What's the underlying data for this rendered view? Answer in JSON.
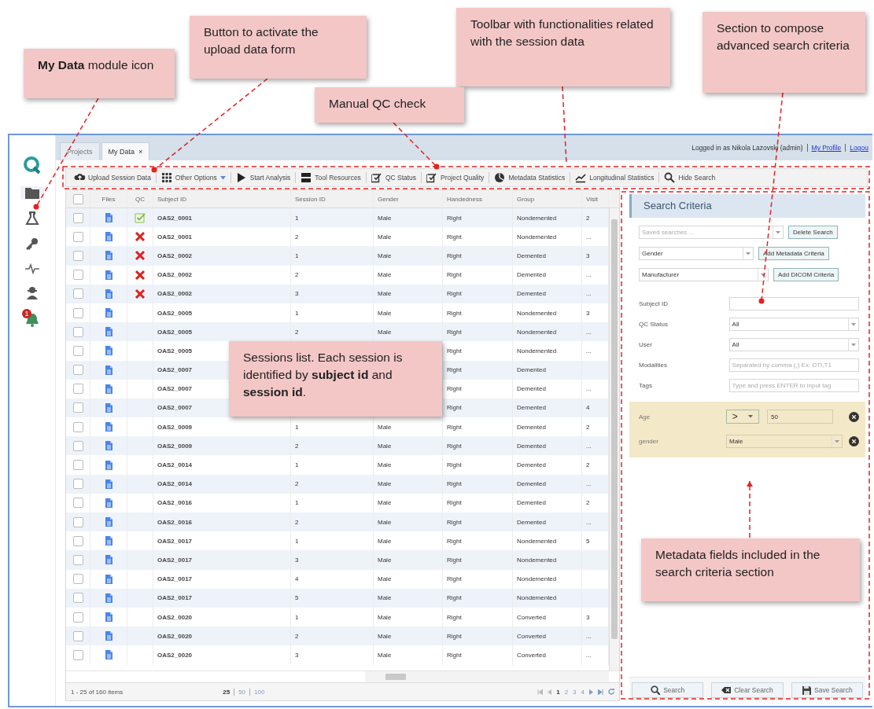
{
  "annotations": [
    {
      "text": "**My Data** module icon"
    },
    {
      "text": "Button to activate the upload data form"
    },
    {
      "text": "Toolbar with functionalities related with the session data"
    },
    {
      "text": "Manual QC check"
    },
    {
      "text": "Section to compose advanced search criteria"
    },
    {
      "text": "Sessions list. Each session is identified by **subject id** and **session id**."
    },
    {
      "text": "Metadata fields included in the search criteria section"
    }
  ],
  "sidebar": {
    "items": [
      {
        "selected": false
      },
      {
        "selected": true
      },
      {
        "selected": false
      },
      {
        "selected": false
      },
      {
        "selected": false
      },
      {
        "selected": false
      },
      {
        "selected": false,
        "badge": "1"
      }
    ]
  },
  "tabs": [
    {
      "label": "Projects",
      "selected": false
    },
    {
      "label": "My Data",
      "selected": true,
      "close": "×"
    }
  ],
  "user_bar": [
    {
      "kind": "text",
      "text": "Logged in as  Nikola Lazovski (admin)"
    },
    {
      "kind": "link",
      "text": "My Profile"
    },
    {
      "kind": "link",
      "text": "Logou"
    }
  ],
  "toolbar": [
    {
      "label": "Upload Session Data",
      "dropdown": false
    },
    {
      "label": "Other Options",
      "dropdown": true
    },
    {
      "label": "Start Analysis",
      "dropdown": false
    },
    {
      "label": "Tool Resources",
      "dropdown": false
    },
    {
      "label": "QC Status",
      "dropdown": false
    },
    {
      "label": "Project Quality",
      "dropdown": false
    },
    {
      "label": "Metadata Statistics",
      "dropdown": false
    },
    {
      "label": "Longitudinal Statistics",
      "dropdown": false
    },
    {
      "label": "Hide Search",
      "dropdown": false
    }
  ],
  "table": {
    "header_checked": false,
    "columns": [
      "Files",
      "QC",
      "Subject ID",
      "Session ID",
      "Gender",
      "Handedness",
      "Group",
      "Visit"
    ],
    "rows": [
      {
        "checked": false,
        "qc_passed": true,
        "subject_id": "OAS2_0001",
        "session_id": "1",
        "gender": "Male",
        "handedness": "Right",
        "group": "Nondemented",
        "visit": "2"
      },
      {
        "checked": false,
        "qc_passed": false,
        "subject_id": "OAS2_0001",
        "session_id": "2",
        "gender": "Male",
        "handedness": "Right",
        "group": "Nondemented",
        "visit": "..."
      },
      {
        "checked": false,
        "qc_passed": false,
        "subject_id": "OAS2_0002",
        "session_id": "1",
        "gender": "Male",
        "handedness": "Right",
        "group": "Demented",
        "visit": "3"
      },
      {
        "checked": false,
        "qc_passed": false,
        "subject_id": "OAS2_0002",
        "session_id": "2",
        "gender": "Male",
        "handedness": "Right",
        "group": "Demented",
        "visit": "..."
      },
      {
        "checked": false,
        "qc_passed": false,
        "subject_id": "OAS2_0002",
        "session_id": "3",
        "gender": "Male",
        "handedness": "Right",
        "group": "Demented",
        "visit": "..."
      },
      {
        "checked": false,
        "subject_id": "OAS2_0005",
        "session_id": "1",
        "gender": "Male",
        "handedness": "Right",
        "group": "Nondemented",
        "visit": "3"
      },
      {
        "checked": false,
        "subject_id": "OAS2_0005",
        "session_id": "2",
        "gender": "Male",
        "handedness": "Right",
        "group": "Nondemented",
        "visit": "..."
      },
      {
        "checked": false,
        "subject_id": "OAS2_0005",
        "handedness": "Right",
        "group": "Nondemented",
        "visit": "..."
      },
      {
        "checked": false,
        "subject_id": "OAS2_0007",
        "handedness": "Right",
        "group": "Demented"
      },
      {
        "checked": false,
        "subject_id": "OAS2_0007",
        "handedness": "Right",
        "group": "Demented",
        "visit": "..."
      },
      {
        "checked": false,
        "subject_id": "OAS2_0007",
        "handedness": "Right",
        "group": "Demented",
        "visit": "4"
      },
      {
        "checked": false,
        "subject_id": "OAS2_0009",
        "session_id": "1",
        "gender": "Male",
        "handedness": "Right",
        "group": "Demented",
        "visit": "2"
      },
      {
        "checked": false,
        "subject_id": "OAS2_0009",
        "session_id": "2",
        "gender": "Male",
        "handedness": "Right",
        "group": "Demented",
        "visit": "..."
      },
      {
        "checked": false,
        "subject_id": "OAS2_0014",
        "session_id": "1",
        "gender": "Male",
        "handedness": "Right",
        "group": "Demented",
        "visit": "2"
      },
      {
        "checked": false,
        "subject_id": "OAS2_0014",
        "session_id": "2",
        "gender": "Male",
        "handedness": "Right",
        "group": "Demented",
        "visit": "..."
      },
      {
        "checked": false,
        "subject_id": "OAS2_0016",
        "session_id": "1",
        "gender": "Male",
        "handedness": "Right",
        "group": "Demented",
        "visit": "2"
      },
      {
        "checked": false,
        "subject_id": "OAS2_0016",
        "session_id": "2",
        "gender": "Male",
        "handedness": "Right",
        "group": "Demented",
        "visit": "..."
      },
      {
        "checked": false,
        "subject_id": "OAS2_0017",
        "session_id": "1",
        "gender": "Male",
        "handedness": "Right",
        "group": "Nondemented",
        "visit": "5"
      },
      {
        "checked": false,
        "subject_id": "OAS2_0017",
        "session_id": "3",
        "gender": "Male",
        "handedness": "Right",
        "group": "Nondemented"
      },
      {
        "checked": false,
        "subject_id": "OAS2_0017",
        "session_id": "4",
        "gender": "Male",
        "handedness": "Right",
        "group": "Nondemented"
      },
      {
        "checked": false,
        "subject_id": "OAS2_0017",
        "session_id": "5",
        "gender": "Male",
        "handedness": "Right",
        "group": "Nondemented"
      },
      {
        "checked": false,
        "subject_id": "OAS2_0020",
        "session_id": "1",
        "gender": "Male",
        "handedness": "Right",
        "group": "Converted",
        "visit": "3"
      },
      {
        "checked": false,
        "subject_id": "OAS2_0020",
        "session_id": "2",
        "gender": "Male",
        "handedness": "Right",
        "group": "Converted",
        "visit": "..."
      },
      {
        "checked": false,
        "subject_id": "OAS2_0020",
        "session_id": "3",
        "gender": "Male",
        "handedness": "Right",
        "group": "Converted",
        "visit": "..."
      }
    ]
  },
  "footer": {
    "summary": "1 - 25 of 160 items",
    "page_sizes": [
      {
        "label": "25",
        "selected": true
      },
      {
        "label": "50",
        "selected": false
      },
      {
        "label": "100",
        "selected": false
      }
    ],
    "pages": [
      {
        "label": "1",
        "selected": true
      },
      {
        "label": "2",
        "selected": false
      },
      {
        "label": "3",
        "selected": false
      },
      {
        "label": "4",
        "selected": false
      }
    ]
  },
  "search": {
    "title": "Search Criteria",
    "pickers": [
      {
        "placeholder": "Saved searches ...",
        "button": "Delete Search"
      },
      {
        "value": "Gender",
        "button": "Add Metadata Criteria"
      },
      {
        "value": "Manufacturer",
        "button": "Add DICOM Criteria"
      }
    ],
    "fields": [
      {
        "label": "Subject ID",
        "kind": "text"
      },
      {
        "label": "QC Status",
        "kind": "select",
        "value": "All"
      },
      {
        "label": "User",
        "kind": "select",
        "value": "All"
      },
      {
        "label": "Modalities",
        "kind": "text",
        "placeholder": "Separated by comma (,) Ex: DTI,T1"
      },
      {
        "label": "Tags",
        "kind": "text",
        "placeholder": "Type and press ENTER to input tag"
      }
    ],
    "criteria": [
      {
        "kind": "compare",
        "label": "Age",
        "operator": ">",
        "value": "50"
      },
      {
        "kind": "select",
        "label": "gender",
        "value": "Male"
      }
    ],
    "buttons": [
      "Search",
      "Clear Search",
      "Save Search"
    ]
  }
}
